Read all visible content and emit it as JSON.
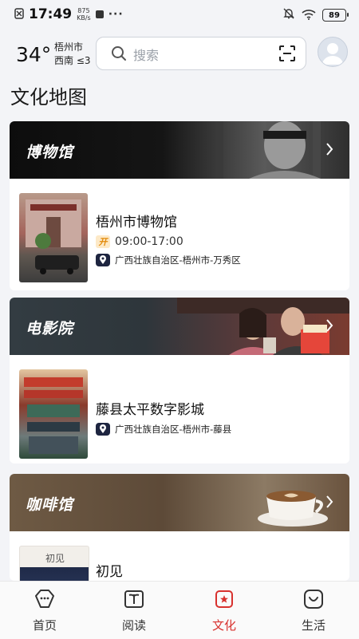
{
  "status_bar": {
    "time": "17:49",
    "speed_value": "875",
    "speed_unit": "KB/s",
    "more": "···",
    "battery": "89"
  },
  "weather": {
    "temperature": "34°",
    "city": "梧州市",
    "wind": "西南 ≤3"
  },
  "search": {
    "placeholder": "搜索"
  },
  "page_title": "文化地图",
  "sections": [
    {
      "title": "博物馆",
      "item": {
        "name": "梧州市博物馆",
        "open_badge": "开",
        "hours": "09:00-17:00",
        "address": "广西壮族自治区-梧州市-万秀区"
      }
    },
    {
      "title": "电影院",
      "item": {
        "name": "藤县太平数字影城",
        "address": "广西壮族自治区-梧州市-藤县"
      }
    },
    {
      "title": "咖啡馆",
      "item": {
        "name": "初见",
        "thumb_text": "初见"
      }
    }
  ],
  "bottom_nav": [
    {
      "label": "首页",
      "icon": "home-icon",
      "active": false
    },
    {
      "label": "阅读",
      "icon": "book-icon",
      "active": false
    },
    {
      "label": "文化",
      "icon": "culture-icon",
      "active": true
    },
    {
      "label": "生活",
      "icon": "life-icon",
      "active": false
    }
  ],
  "colors": {
    "accent": "#d8312e",
    "background": "#f3f4f7",
    "badge_orange": "#e28a0a",
    "address_icon": "#1e2540"
  }
}
